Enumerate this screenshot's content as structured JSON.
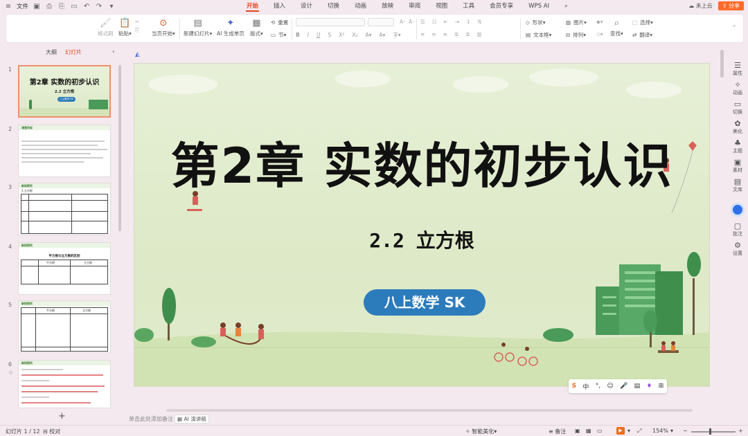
{
  "topbar": {
    "file_label": "文件",
    "tabs": [
      "开始",
      "插入",
      "设计",
      "切换",
      "动画",
      "放映",
      "审阅",
      "视图",
      "工具",
      "会员专享",
      "WPS AI"
    ],
    "active_tab": "开始",
    "cloud_label": "未上云",
    "share_label": "分享"
  },
  "ribbon": {
    "format_painter": "格式刷",
    "paste": "粘贴",
    "from_current": "当页开始",
    "new_slide": "新建幻灯片",
    "ai_generate": "AI 生成单页",
    "layout": "版式",
    "section": "节",
    "reset": "重置",
    "shape": "形状",
    "picture": "图片",
    "select": "选择",
    "textbox": "文本框",
    "arrange": "排列",
    "find": "查找",
    "replace": "翻译"
  },
  "leftpanel": {
    "tab_outline": "大纲",
    "tab_slides": "幻灯片",
    "thumbnails": [
      {
        "num": "1",
        "title": "第2章 实数的初步认识",
        "sub": "2.2 立方根",
        "badge": "八上数学 SK"
      },
      {
        "num": "2",
        "title": "课堂目标"
      },
      {
        "num": "3",
        "title": "新知探究"
      },
      {
        "num": "4",
        "title": "新知探究"
      },
      {
        "num": "5",
        "title": "新知探究"
      },
      {
        "num": "6",
        "title": "新知探究"
      }
    ],
    "thumb3_header": "1.立方根",
    "thumb4_caption": "平方根与立方根的区别",
    "thumb4_cols": [
      "平方根",
      "立方根"
    ],
    "thumb5_cols": [
      "平方根",
      "立方根"
    ]
  },
  "slide": {
    "title": "第2章  实数的初步认识",
    "subtitle": "2.2 立方根",
    "badge": "八上数学 SK"
  },
  "floatbar": {
    "items": [
      "S",
      "中",
      "°,",
      "☺",
      "🎤",
      "▤",
      "♦",
      "⊞"
    ]
  },
  "rightbar": {
    "items": [
      "属性",
      "动画",
      "切换",
      "美化",
      "主题",
      "素材",
      "文库",
      "批注",
      "设置"
    ]
  },
  "notebar": {
    "placeholder": "单击此处添加备注",
    "ai_script": "AI 演讲稿"
  },
  "status": {
    "slide_count": "幻灯片 1 / 12",
    "proofread": "校对",
    "smart_beautify": "智能美化",
    "notes": "备注",
    "zoom": "154%"
  }
}
